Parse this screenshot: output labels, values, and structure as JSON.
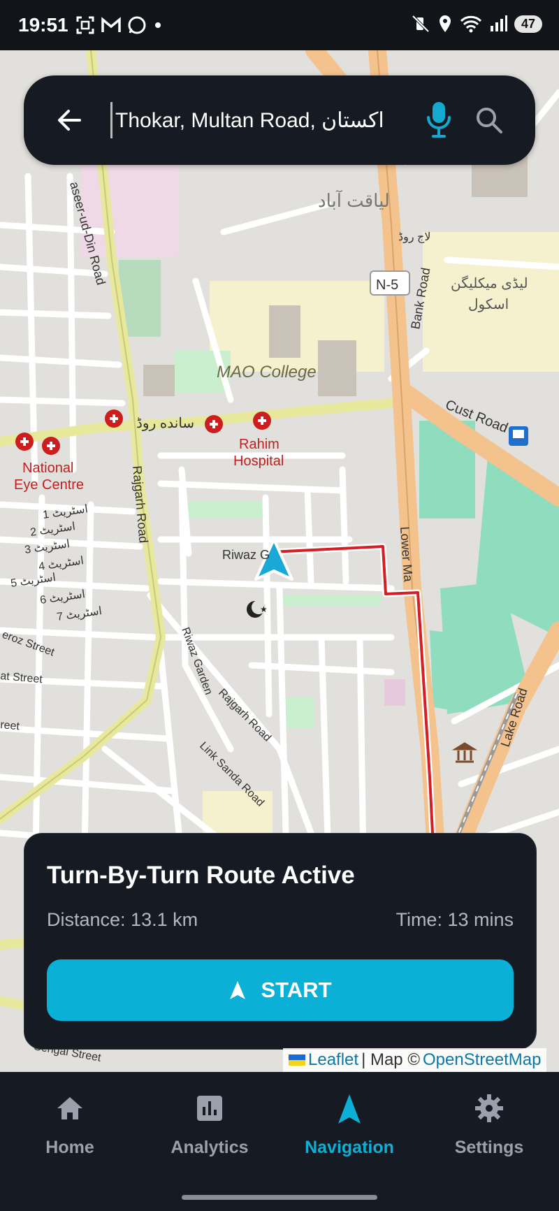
{
  "status_bar": {
    "time": "19:51",
    "battery": "47"
  },
  "search": {
    "value": "Thokar, Multan Road, اکستان"
  },
  "map_labels": {
    "liaqatabad": "لیاقت آباد",
    "lajroad": "لاج روڈ",
    "n5": "N-5",
    "bank_road": "Bank Road",
    "lady_mclagan": "لیڈی میکلیگن",
    "school": "اسکول",
    "mao_college": "MAO College",
    "cust_road": "Cust Road",
    "sanda_road": "سانده روڈ",
    "rahim": "Rahim",
    "hospital": "Hospital",
    "national": "National",
    "eye_centre": "Eye Centre",
    "street1": "1 اسٹریٹ",
    "street2": "2 اسٹریٹ",
    "street3": "3 اسٹریٹ",
    "street4": "4 اسٹریٹ",
    "street5": "5 اسٹریٹ",
    "street6": "6 اسٹریٹ",
    "street7": "7 اسٹریٹ",
    "rajgarh_road": "Rajgarh Road",
    "naseer": "aseer-ud-Din Road",
    "riwaz": "Riwaz G",
    "riwaz_garden": "Riwaz Garden",
    "rajgarh_road2": "Rajgarh Road",
    "link_sanda": "Link Sanda Road",
    "lower_mall": "Lower Ma",
    "lake_road": "Lake Road",
    "feroz": "eroz Street",
    "at_street": "at Street",
    "reet": "reet",
    "sengal": "Sengal Street"
  },
  "route_card": {
    "title": "Turn-By-Turn Route Active",
    "distance": "Distance: 13.1 km",
    "time": "Time: 13 mins",
    "start_label": "START"
  },
  "attribution": {
    "leaflet": "Leaflet",
    "sep": " | Map © ",
    "osm": "OpenStreetMap"
  },
  "nav": [
    {
      "label": "Home",
      "icon": "home-icon"
    },
    {
      "label": "Analytics",
      "icon": "analytics-icon"
    },
    {
      "label": "Navigation",
      "icon": "navigation-icon",
      "active": true
    },
    {
      "label": "Settings",
      "icon": "gear-icon"
    }
  ],
  "colors": {
    "accent": "#0ab0d6",
    "panel": "#161a22",
    "route": "#d41f26"
  }
}
